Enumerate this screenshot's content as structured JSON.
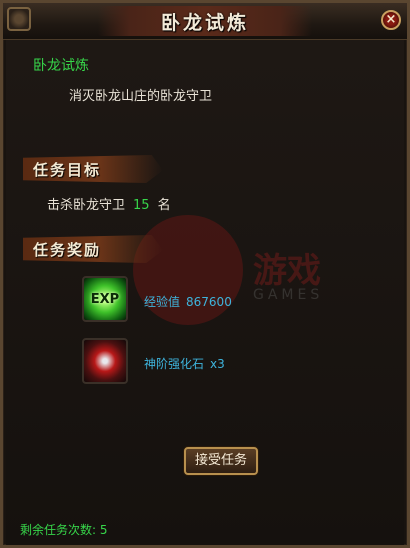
{
  "window": {
    "title": "卧龙试炼",
    "close_label": "×"
  },
  "quest": {
    "name": "卧龙试炼",
    "description": "消灭卧龙山庄的卧龙守卫"
  },
  "objective_section": {
    "title": "任务目标",
    "prefix": "击杀卧龙守卫",
    "count": "15",
    "suffix": "名"
  },
  "reward_section": {
    "title": "任务奖励",
    "items": [
      {
        "icon": "exp-icon",
        "icon_text": "EXP",
        "name": "经验值",
        "amount": "867600"
      },
      {
        "icon": "enhancement-stone-icon",
        "name": "神阶强化石",
        "amount": "x3"
      }
    ]
  },
  "watermark": {
    "text": "游戏",
    "sub": "GAMES"
  },
  "actions": {
    "accept_label": "接受任务"
  },
  "footer": {
    "remaining_text": "剩余任务次数: 5"
  },
  "colors": {
    "quest_green": "#37d54a",
    "reward_blue": "#3eb4dc",
    "banner_brown": "#6a3418"
  }
}
